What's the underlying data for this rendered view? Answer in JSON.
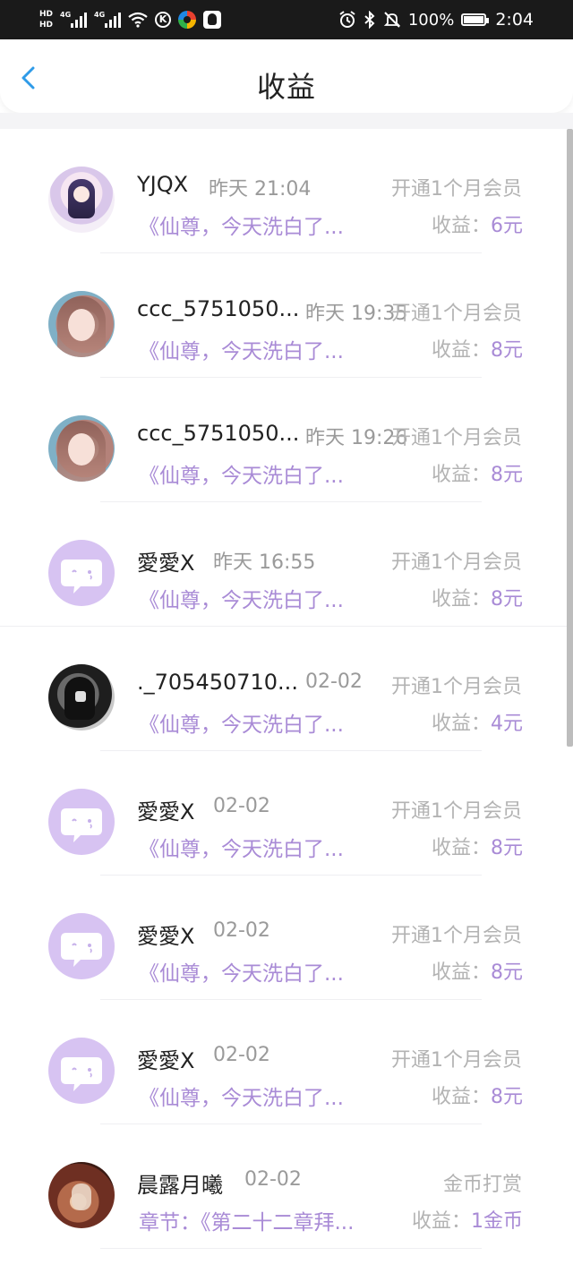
{
  "status_bar": {
    "hd_top": "HD",
    "hd_bottom": "HD",
    "net1": "4G",
    "net2": "4G",
    "k_icon": "K",
    "battery_pct": "100%",
    "time": "2:04"
  },
  "header": {
    "title": "收益"
  },
  "colors": {
    "accent_purple": "#a98bd6",
    "back_blue": "#2f9be8",
    "status_bar_bg": "#1a1a1a"
  },
  "rows": [
    {
      "avatar": "anime-girl-avatar",
      "username": "YJQX",
      "time": "昨天 21:04",
      "type": "开通1个月会员",
      "book": "《仙尊，今天洗白了...",
      "earn_label": "收益：",
      "earn_amount": "6元"
    },
    {
      "avatar": "portrait-girl-avatar",
      "username": "ccc_5751050...",
      "time": "昨天 19:35",
      "type": "开通1个月会员",
      "book": "《仙尊，今天洗白了...",
      "earn_label": "收益：",
      "earn_amount": "8元"
    },
    {
      "avatar": "portrait-girl-avatar",
      "username": "ccc_5751050...",
      "time": "昨天 19:26",
      "type": "开通1个月会员",
      "book": "《仙尊，今天洗白了...",
      "earn_label": "收益：",
      "earn_amount": "8元"
    },
    {
      "avatar": "chat-bubble-avatar",
      "username": "愛愛X",
      "time": "昨天 16:55",
      "type": "开通1个月会员",
      "book": "《仙尊，今天洗白了...",
      "earn_label": "收益：",
      "earn_amount": "8元"
    },
    {
      "avatar": "photo-avatar",
      "username": "._705450710...",
      "time": "02-02",
      "type": "开通1个月会员",
      "book": "《仙尊，今天洗白了...",
      "earn_label": "收益：",
      "earn_amount": "4元"
    },
    {
      "avatar": "chat-bubble-avatar",
      "username": "愛愛X",
      "time": "02-02",
      "type": "开通1个月会员",
      "book": "《仙尊，今天洗白了...",
      "earn_label": "收益：",
      "earn_amount": "8元"
    },
    {
      "avatar": "chat-bubble-avatar",
      "username": "愛愛X",
      "time": "02-02",
      "type": "开通1个月会员",
      "book": "《仙尊，今天洗白了...",
      "earn_label": "收益：",
      "earn_amount": "8元"
    },
    {
      "avatar": "chat-bubble-avatar",
      "username": "愛愛X",
      "time": "02-02",
      "type": "开通1个月会员",
      "book": "《仙尊，今天洗白了...",
      "earn_label": "收益：",
      "earn_amount": "8元"
    },
    {
      "avatar": "artwork-avatar",
      "username": "晨露月曦",
      "time": "02-02",
      "type": "金币打赏",
      "book": "章节：《第二十二章拜...",
      "earn_label": "收益：",
      "earn_amount": "1金币"
    }
  ]
}
